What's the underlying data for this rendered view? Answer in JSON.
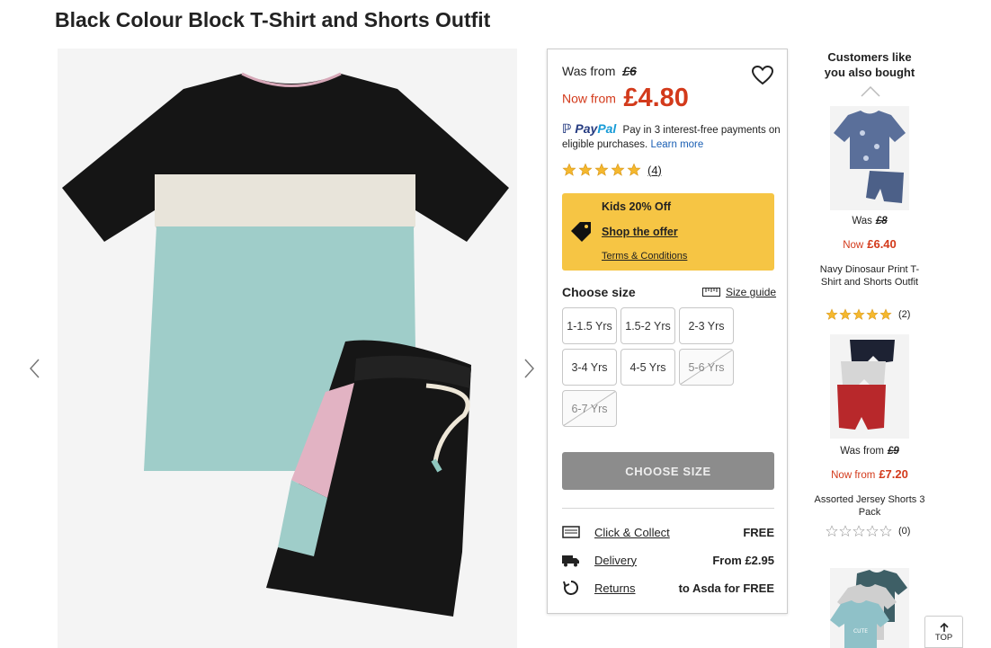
{
  "product": {
    "title": "Black Colour Block T-Shirt and Shorts Outfit"
  },
  "gallery": {
    "prev_icon": "chevron-left-icon",
    "next_icon": "chevron-right-icon"
  },
  "pricing": {
    "was_label": "Was from",
    "was_price": "£6",
    "now_label": "Now from",
    "now_price": "£4.80",
    "price_color": "#d33a1b"
  },
  "wishlist": {
    "icon": "heart-icon"
  },
  "paypal": {
    "logo_pay": "Pay",
    "logo_pal": "Pal",
    "message": "Pay in 3 interest-free payments on eligible purchases.",
    "learn_more": "Learn more"
  },
  "rating": {
    "stars": 5,
    "count": "(4)"
  },
  "offer": {
    "title": "Kids 20% Off",
    "shop_link": "Shop the offer",
    "terms_link": "Terms & Conditions",
    "background": "#f6c544"
  },
  "size_selector": {
    "label": "Choose size",
    "guide_label": "Size guide",
    "sizes": [
      {
        "label": "1-1.5 Yrs",
        "available": true
      },
      {
        "label": "1.5-2 Yrs",
        "available": true
      },
      {
        "label": "2-3 Yrs",
        "available": true
      },
      {
        "label": "3-4 Yrs",
        "available": true
      },
      {
        "label": "4-5 Yrs",
        "available": true
      },
      {
        "label": "5-6 Yrs",
        "available": false
      },
      {
        "label": "6-7 Yrs",
        "available": false
      }
    ],
    "button_label": "CHOOSE SIZE"
  },
  "fulfilment": [
    {
      "label": "Click & Collect",
      "value": "FREE",
      "icon": "store-icon"
    },
    {
      "label": "Delivery",
      "value": "From £2.95",
      "icon": "truck-icon"
    },
    {
      "label": "Returns",
      "value": "to Asda for FREE",
      "icon": "returns-icon"
    }
  ],
  "recommendations": {
    "title": "Customers like you also bought",
    "items": [
      {
        "was_label": "Was",
        "was_price": "£8",
        "now_label": "Now",
        "now_price": "£6.40",
        "name": "Navy Dinosaur Print T-Shirt and Shorts Outfit",
        "stars": 5,
        "count": "(2)"
      },
      {
        "was_label": "Was from",
        "was_price": "£9",
        "now_label": "Now from",
        "now_price": "£7.20",
        "name": "Assorted Jersey Shorts 3 Pack",
        "stars": 0,
        "count": "(0)"
      },
      {
        "image_text": "CUTE"
      }
    ]
  },
  "back_to_top": {
    "label": "TOP"
  }
}
